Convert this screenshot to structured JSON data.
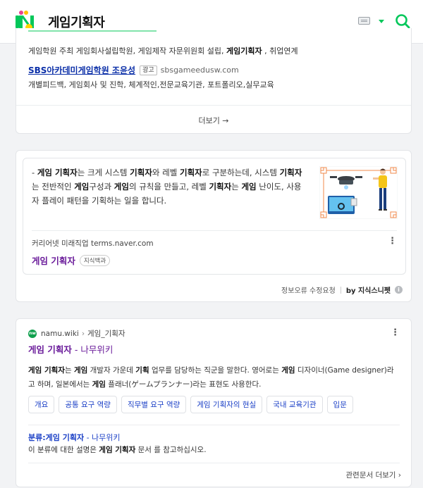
{
  "header": {
    "query": "게임기획자",
    "colors": {
      "brand_green": "#03c75a"
    }
  },
  "ad": {
    "desc1_plain1": "게임학원 주최 게임회사설립학원, 게임제작 자문위원회 설립, ",
    "desc1_bold": "게임기획자",
    "desc1_plain2": " , 취업연계",
    "title": "SBS아카데미게임학원 조윤성",
    "badge": "광고",
    "url": "sbsgameedusw.com",
    "desc2": "개별피드백, 게임회사 및 진학, 체계적인,전문교육기관, 포트폴리오,실무교육",
    "more": "더보기 →"
  },
  "knowledge": {
    "text": [
      {
        "t": "- ",
        "b": false
      },
      {
        "t": "게임 기획자",
        "b": true
      },
      {
        "t": "는 크게 시스템 ",
        "b": false
      },
      {
        "t": "기획자",
        "b": true
      },
      {
        "t": "와 레벨 ",
        "b": false
      },
      {
        "t": "기획자",
        "b": true
      },
      {
        "t": "로 구분하는데, 시스템 ",
        "b": false
      },
      {
        "t": "기획자",
        "b": true
      },
      {
        "t": "는 전반적인 ",
        "b": false
      },
      {
        "t": "게임",
        "b": true
      },
      {
        "t": "구성과 ",
        "b": false
      },
      {
        "t": "게임",
        "b": true
      },
      {
        "t": "의 규칙을 만들고, 레벨 ",
        "b": false
      },
      {
        "t": "기획자",
        "b": true
      },
      {
        "t": "는 ",
        "b": false
      },
      {
        "t": "게임",
        "b": true
      },
      {
        "t": " 난이도, 사용자 플레이 패턴을 기획하는 일을 합니다.",
        "b": false
      }
    ],
    "source": "커리어넷 미래직업 terms.naver.com",
    "title": "게임 기획자",
    "chip": "지식백과",
    "report": "정보오류 수정요청",
    "brand": "by 지식스니펫"
  },
  "namu": {
    "site": "namu.wiki",
    "crumb_sep": "›",
    "crumb": "게임_기획자",
    "title_bold": "게임 기획자",
    "title_rest": " - 나무위키",
    "desc": [
      {
        "t": "게임 기획자",
        "b": true
      },
      {
        "t": "는 ",
        "b": false
      },
      {
        "t": "게임",
        "b": true
      },
      {
        "t": " 개발자 가운데 ",
        "b": false
      },
      {
        "t": "기획",
        "b": true
      },
      {
        "t": " 업무를 담당하는 직군을 말한다. 영어로는 ",
        "b": false
      },
      {
        "t": "게임",
        "b": true
      },
      {
        "t": " 디자이너(Game designer)라고 하며, 일본에서는 ",
        "b": false
      },
      {
        "t": "게임",
        "b": true
      },
      {
        "t": " 플래너(ゲームプランナー)라는 표현도 사용한다.",
        "b": false
      }
    ],
    "tags": [
      "개요",
      "공통 요구 역량",
      "직무별 요구 역량",
      "게임 기획자의 현실",
      "국내 교육기관",
      "입문"
    ],
    "sub_title_bold": "분류:게임 기획자",
    "sub_title_rest": " - 나무위키",
    "sub_desc_plain1": "이 분류에 대한 설명은 ",
    "sub_desc_bold": "게임 기획자",
    "sub_desc_plain2": " 문서 를 참고하십시오.",
    "related_more": "관련문서 더보기 ›"
  }
}
